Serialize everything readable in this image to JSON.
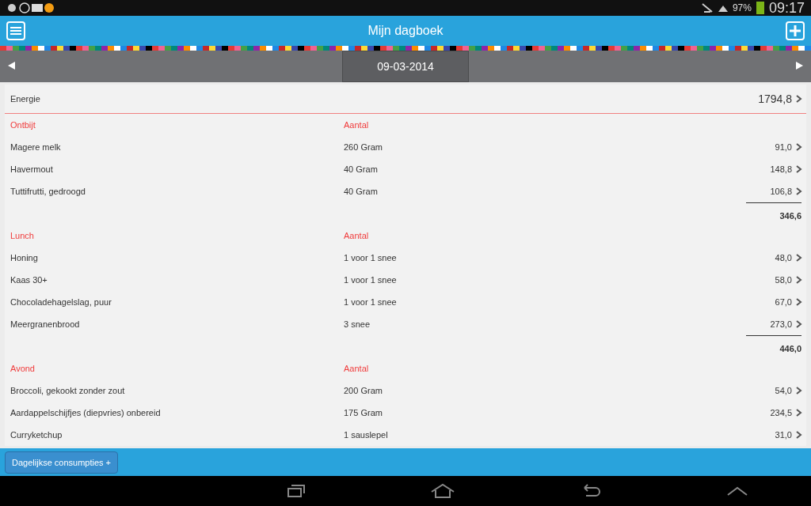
{
  "status_bar": {
    "battery": "97%",
    "time": "09:17"
  },
  "header": {
    "title": "Mijn dagboek"
  },
  "date_bar": {
    "date": "09-03-2014"
  },
  "energy": {
    "label": "Energie",
    "value": "1794,8"
  },
  "meals": [
    {
      "name": "Ontbijt",
      "quantity_heading": "Aantal",
      "items": [
        {
          "food": "Magere melk",
          "amount": "260 Gram",
          "energy": "91,0"
        },
        {
          "food": "Havermout",
          "amount": "40 Gram",
          "energy": "148,8"
        },
        {
          "food": "Tuttifrutti, gedroogd",
          "amount": "40 Gram",
          "energy": "106,8"
        }
      ],
      "total": "346,6"
    },
    {
      "name": "Lunch",
      "quantity_heading": "Aantal",
      "items": [
        {
          "food": "Honing",
          "amount": "1 voor 1 snee",
          "energy": "48,0"
        },
        {
          "food": "Kaas 30+",
          "amount": "1 voor 1 snee",
          "energy": "58,0"
        },
        {
          "food": "Chocoladehagelslag, puur",
          "amount": "1 voor 1 snee",
          "energy": "67,0"
        },
        {
          "food": "Meergranenbrood",
          "amount": "3 snee",
          "energy": "273,0"
        }
      ],
      "total": "446,0"
    },
    {
      "name": "Avond",
      "quantity_heading": "Aantal",
      "items": [
        {
          "food": "Broccoli, gekookt zonder zout",
          "amount": "200 Gram",
          "energy": "54,0"
        },
        {
          "food": "Aardappelschijfjes (diepvries) onbereid",
          "amount": "175 Gram",
          "energy": "234,5"
        },
        {
          "food": "Curryketchup",
          "amount": "1 sauslepel",
          "energy": "31,0"
        }
      ]
    }
  ],
  "footer": {
    "button": "Dagelijkse consumpties +"
  }
}
